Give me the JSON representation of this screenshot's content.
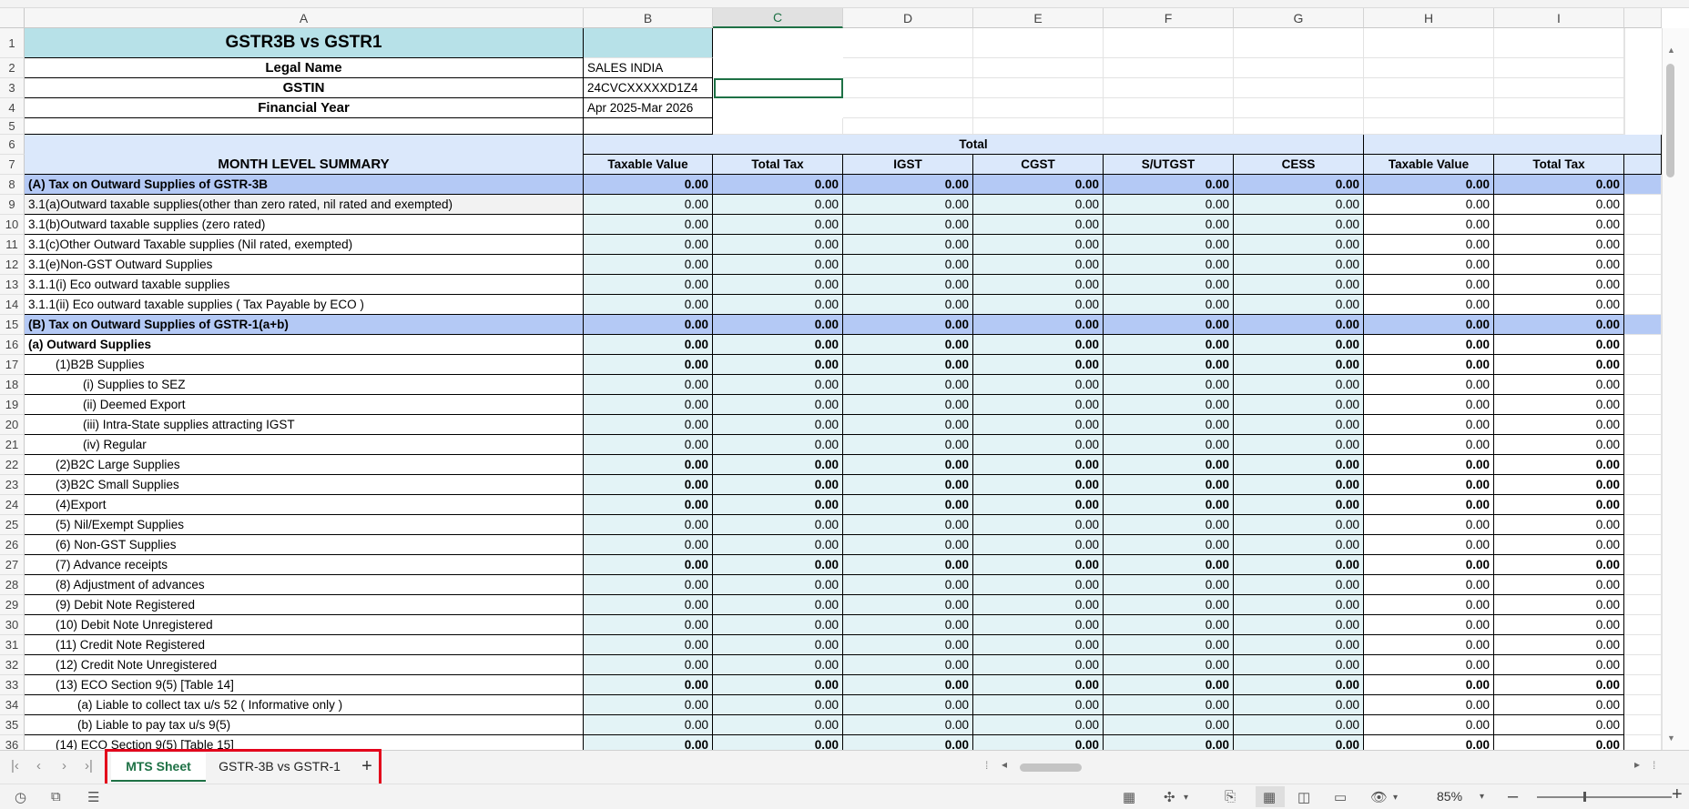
{
  "columns": [
    "A",
    "B",
    "C",
    "D",
    "E",
    "F",
    "G",
    "H",
    "I"
  ],
  "selected_column": "C",
  "header_block": {
    "title": "GSTR3B vs GSTR1",
    "legal_name_label": "Legal  Name",
    "legal_name_value": "SALES INDIA",
    "gstin_label": "GSTIN",
    "gstin_value": "24CVCXXXXXD1Z4",
    "fy_label": "Financial Year",
    "fy_value": "Apr 2025-Mar 2026",
    "summary_label": "MONTH LEVEL SUMMARY",
    "total_label": "Total"
  },
  "value_headers": [
    "Taxable Value",
    "Total Tax",
    "IGST",
    "CGST",
    "S/UTGST",
    "CESS",
    "Taxable Value",
    "Total Tax"
  ],
  "rows": [
    {
      "num": "8",
      "label": "(A) Tax on Outward Supplies of GSTR-3B",
      "indent": 0,
      "bold": true,
      "section": true
    },
    {
      "num": "9",
      "label": "3.1(a)Outward taxable supplies(other than zero rated, nil rated and exempted)",
      "indent": 0,
      "bold": false,
      "gray": true
    },
    {
      "num": "10",
      "label": "3.1(b)Outward taxable supplies (zero rated)",
      "indent": 0,
      "bold": false
    },
    {
      "num": "11",
      "label": "3.1(c)Other Outward Taxable supplies (Nil rated, exempted)",
      "indent": 0,
      "bold": false
    },
    {
      "num": "12",
      "label": "3.1(e)Non-GST Outward Supplies",
      "indent": 0,
      "bold": false
    },
    {
      "num": "13",
      "label": "3.1.1(i) Eco outward taxable supplies",
      "indent": 0,
      "bold": false
    },
    {
      "num": "14",
      "label": "3.1.1(ii) Eco outward taxable supplies ( Tax Payable by ECO )",
      "indent": 0,
      "bold": false
    },
    {
      "num": "15",
      "label": "(B) Tax on Outward Supplies of GSTR-1(a+b)",
      "indent": 0,
      "bold": true,
      "section": true
    },
    {
      "num": "16",
      "label": "(a) Outward Supplies",
      "indent": 0,
      "bold": true,
      "labelbold": true
    },
    {
      "num": "17",
      "label": "(1)B2B Supplies",
      "indent": 1,
      "bold": true
    },
    {
      "num": "18",
      "label": "(i) Supplies to SEZ",
      "indent": 2,
      "bold": false
    },
    {
      "num": "19",
      "label": "(ii) Deemed Export",
      "indent": 2,
      "bold": false
    },
    {
      "num": "20",
      "label": "(iii) Intra-State supplies attracting IGST",
      "indent": 2,
      "bold": false
    },
    {
      "num": "21",
      "label": "(iv) Regular",
      "indent": 2,
      "bold": false
    },
    {
      "num": "22",
      "label": "(2)B2C Large Supplies",
      "indent": 1,
      "bold": true
    },
    {
      "num": "23",
      "label": "(3)B2C Small Supplies",
      "indent": 1,
      "bold": true
    },
    {
      "num": "24",
      "label": "(4)Export",
      "indent": 1,
      "bold": true
    },
    {
      "num": "25",
      "label": "(5) Nil/Exempt Supplies",
      "indent": 1,
      "bold": false
    },
    {
      "num": "26",
      "label": "(6) Non-GST Supplies",
      "indent": 1,
      "bold": false
    },
    {
      "num": "27",
      "label": "(7) Advance receipts",
      "indent": 1,
      "bold": true
    },
    {
      "num": "28",
      "label": "(8) Adjustment of advances",
      "indent": 1,
      "bold": false
    },
    {
      "num": "29",
      "label": "(9) Debit Note Registered",
      "indent": 1,
      "bold": false
    },
    {
      "num": "30",
      "label": "(10) Debit Note Unregistered",
      "indent": 1,
      "bold": false
    },
    {
      "num": "31",
      "label": "(11) Credit Note Registered",
      "indent": 1,
      "bold": false
    },
    {
      "num": "32",
      "label": "(12) Credit Note Unregistered",
      "indent": 1,
      "bold": false
    },
    {
      "num": "33",
      "label": "(13) ECO Section 9(5)  [Table 14]",
      "indent": 1,
      "bold": true
    },
    {
      "num": "34",
      "label": "(a) Liable to collect tax u/s 52 ( Informative only )",
      "indent": 1.8,
      "bold": false
    },
    {
      "num": "35",
      "label": "(b) Liable to pay tax u/s 9(5)",
      "indent": 1.8,
      "bold": false
    },
    {
      "num": "36",
      "label": "(14) ECO Section 9(5) [Table 15]",
      "indent": 1,
      "bold": true
    }
  ],
  "zero_value": "0.00",
  "sheet_tabs": [
    {
      "label": "MTS Sheet",
      "active": true
    },
    {
      "label": "GSTR-3B vs GSTR-1",
      "active": false
    }
  ],
  "add_sheet_label": "+",
  "zoom": "85%",
  "colors": {
    "header_blue": "#b7e1e8",
    "section_blue": "#b4c9f5",
    "light_blue": "#dbe8fb",
    "value_teal": "#e3f3f6",
    "accent_green": "#1e7145",
    "highlight_red": "#e3001b"
  }
}
